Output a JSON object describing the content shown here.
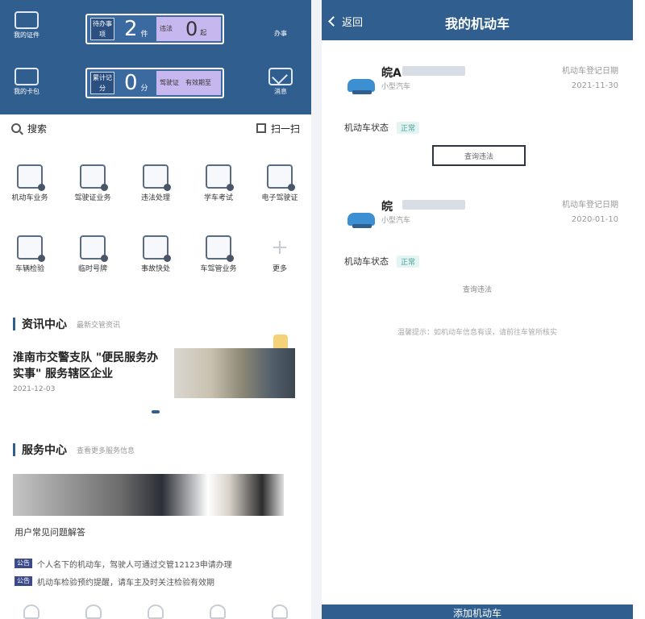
{
  "left": {
    "hero": {
      "icons": [
        {
          "icon": "document-icon",
          "label": "我的证件"
        },
        {
          "icon": "note-icon",
          "label": "办事"
        },
        {
          "icon": "card-icon",
          "label": "我的卡包"
        },
        {
          "icon": "mail-icon",
          "label": "消息"
        }
      ],
      "counters": [
        {
          "label": "待办事项",
          "value": "2",
          "unit": "件",
          "seg_label": "违法",
          "seg_value": "0",
          "seg_unit": "起"
        },
        {
          "label": "累计记分",
          "value": "0",
          "unit": "分",
          "seg_label": "驾驶证",
          "seg_detail": "有效期至"
        }
      ]
    },
    "search": {
      "placeholder": "搜索",
      "scan_label": "扫一扫"
    },
    "services": [
      {
        "label": "机动车业务"
      },
      {
        "label": "驾驶证业务"
      },
      {
        "label": "违法处理"
      },
      {
        "label": "学车考试"
      },
      {
        "label": "电子驾驶证"
      },
      {
        "label": "车辆检验"
      },
      {
        "label": "临时号牌"
      },
      {
        "label": "事故快处"
      },
      {
        "label": "车驾管业务"
      },
      {
        "label": "更多"
      }
    ],
    "news": {
      "title": "资讯中心",
      "subtitle": "最新交管资讯",
      "headline": "淮南市交警支队 \"便民服务办实事\" 服务辖区企业",
      "date": "2021-12-03"
    },
    "service_center": {
      "title": "服务中心",
      "subtitle": "查看更多服务信息",
      "caption": "用户常见问题解答",
      "items": [
        {
          "tag": "公告",
          "text": "个人名下的机动车，驾驶人可通过交管12123申请办理"
        },
        {
          "tag": "公告",
          "text": "机动车检验预约提醒，请车主及时关注检验有效期"
        }
      ]
    }
  },
  "right": {
    "nav": {
      "back_label": "返回",
      "title": "我的机动车"
    },
    "vehicles": [
      {
        "plate": "皖A",
        "owner_label": "小型汽车",
        "meta_line1": "机动车登记日期",
        "meta_line2": "2021-11-30"
      },
      {
        "plate": "皖",
        "owner_label": "小型汽车",
        "meta_line1": "机动车登记日期",
        "meta_line2": "2020-01-10"
      }
    ],
    "status_label": "机动车状态",
    "status_chip": "正常",
    "query_label": "查询违法",
    "note": "温馨提示：如机动车信息有误，请前往车管所核实",
    "bottom_button": "添加机动车"
  },
  "colors": {
    "brand": "#2f5e8f",
    "accent_purple": "#c7b7ef",
    "status_green": "#4aa39a"
  }
}
